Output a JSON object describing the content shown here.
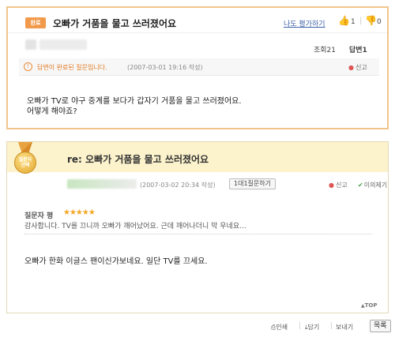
{
  "question": {
    "badge": "완료",
    "title": "오빠가 거품을 물고 쓰러졌어요",
    "eval_link": "나도 평가하기",
    "votes_up": "1",
    "votes_down": "0",
    "views": "조회21",
    "answers": "답변1",
    "status_text": "답변이 완료된 질문입니다.",
    "date": "(2007-03-01 19:16 작성)",
    "report": "신고",
    "body_line1": "오빠가 TV로 야구 중계를 보다가 갑자기 거품을 물고 쓰러졌어요.",
    "body_line2": "어떻게 해야죠?"
  },
  "answer": {
    "medal_line1": "질문자",
    "medal_line2": "선택",
    "title_prefix": "re:",
    "title": "오빠가 거품을 물고 쓰러졌어요",
    "date": "(2007-03-02 20:34 작성)",
    "qa_button": "1대1질문하기",
    "report": "신고",
    "objection": "이의제기",
    "rating_label": "질문자 평",
    "stars": "★★★★★",
    "review": "감사합니다. TV를 끄니까 오빠가 깨어났어요. 근데 깨어나더니 막 우네요...",
    "body": "오빠가 한화 이글스 팬이신가보네요. 일단 TV를 끄세요.",
    "top": "TOP"
  },
  "footer": {
    "print": "인쇄",
    "save": "담기",
    "send": "보내기",
    "list": "목록"
  },
  "colors": {
    "accent": "#f29a4b",
    "answer_header_bg": "#fcf3cc",
    "link": "#3b5fa8"
  }
}
